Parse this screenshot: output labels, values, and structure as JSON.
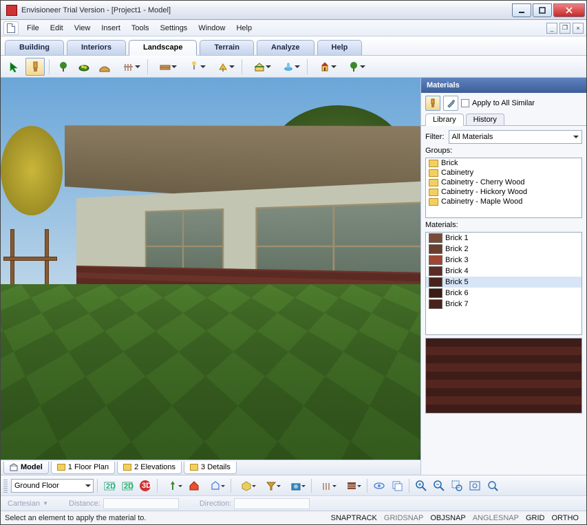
{
  "title": "Envisioneer Trial Version - [Project1 - Model]",
  "menu": [
    "File",
    "Edit",
    "View",
    "Insert",
    "Tools",
    "Settings",
    "Window",
    "Help"
  ],
  "main_tabs": [
    "Building",
    "Interiors",
    "Landscape",
    "Terrain",
    "Analyze",
    "Help"
  ],
  "active_main_tab": 2,
  "view_tabs": [
    "Model",
    "1 Floor Plan",
    "2 Elevations",
    "3 Details"
  ],
  "active_view_tab": 0,
  "location_selector": "Ground Floor",
  "materials": {
    "title": "Materials",
    "apply_all": "Apply to All Similar",
    "subtabs": [
      "Library",
      "History"
    ],
    "active_subtab": 0,
    "filter_label": "Filter:",
    "filter_value": "All Materials",
    "groups_label": "Groups:",
    "groups": [
      "Brick",
      "Cabinetry",
      "Cabinetry - Cherry Wood",
      "Cabinetry - Hickory Wood",
      "Cabinetry - Maple Wood"
    ],
    "materials_label": "Materials:",
    "materials_list": [
      "Brick 1",
      "Brick 2",
      "Brick 3",
      "Brick 4",
      "Brick 5",
      "Brick 6",
      "Brick 7"
    ],
    "selected_material": 4
  },
  "coords": {
    "mode": "Cartesian",
    "distance": "Distance:",
    "direction": "Direction:"
  },
  "status": {
    "message": "Select an element to apply the material to.",
    "snaps": [
      {
        "label": "SNAPTRACK",
        "on": true
      },
      {
        "label": "GRIDSNAP",
        "on": false
      },
      {
        "label": "OBJSNAP",
        "on": true
      },
      {
        "label": "ANGLESNAP",
        "on": false
      },
      {
        "label": "GRID",
        "on": true
      },
      {
        "label": "ORTHO",
        "on": true
      }
    ]
  }
}
